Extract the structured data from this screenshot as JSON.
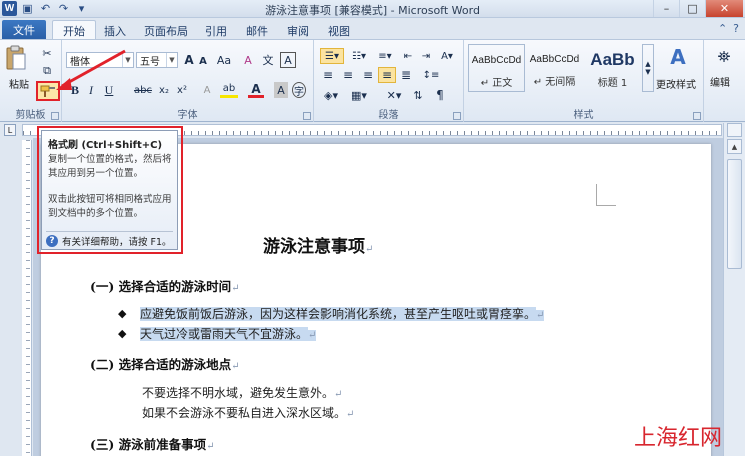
{
  "window": {
    "title": "游泳注意事项 [兼容模式] - Microsoft Word",
    "controls": {
      "minimize": "–",
      "maximize": "□",
      "close": "✕"
    }
  },
  "quick_access": {
    "logo": "W"
  },
  "tabs": {
    "file": "文件",
    "items": [
      "开始",
      "插入",
      "页面布局",
      "引用",
      "邮件",
      "审阅",
      "视图"
    ],
    "active": "开始"
  },
  "ribbon": {
    "clipboard": {
      "label": "剪贴板",
      "paste": "粘贴"
    },
    "font": {
      "label": "字体",
      "font_name": "楷体",
      "font_size": "五号",
      "grow": "A",
      "shrink": "A",
      "case": "Aa",
      "clear": "A",
      "bold": "B",
      "italic": "I",
      "underline": "U",
      "strike": "abc",
      "subscript": "x₂",
      "superscript": "x²",
      "highlight": "ab",
      "font_color": "A",
      "char_shading": "A",
      "char_border": "A",
      "phonetic": "文",
      "enclose": "字"
    },
    "paragraph": {
      "label": "段落"
    },
    "styles": {
      "label": "样式",
      "items": [
        {
          "sample": "AaBbCcDd",
          "name": "↵ 正文"
        },
        {
          "sample": "AaBbCcDd",
          "name": "↵ 无间隔"
        },
        {
          "sample": "AaBb",
          "name": "标题 1"
        }
      ],
      "change_styles": "更改样式"
    },
    "editing": {
      "label": "编辑"
    }
  },
  "tooltip": {
    "title": "格式刷 (Ctrl+Shift+C)",
    "body1": "复制一个位置的格式，然后将其应用到另一个位置。",
    "body2": "双击此按钮可将相同格式应用到文档中的多个位置。",
    "help": "有关详细帮助，请按 F1。"
  },
  "document": {
    "title": "游泳注意事项",
    "sections": [
      {
        "heading": "(一) 选择合适的游泳时间",
        "bullets": [
          "应避免饭前饭后游泳，因为这样会影响消化系统，甚至产生呕吐或胃痉挛。",
          "天气过冷或雷雨天气不宜游泳。"
        ]
      },
      {
        "heading": "(二) 选择合适的游泳地点",
        "lines": [
          "不要选择不明水域，避免发生意外。",
          "如果不会游泳不要私自进入深水区域。"
        ]
      },
      {
        "heading": "(三) 游泳前准备事项"
      }
    ],
    "para_mark": "↵",
    "bullet_glyph": "◆"
  },
  "watermark": "上海红网",
  "colors": {
    "highlight_red": "#e1222a",
    "selection": "#c7daf0",
    "accent": "#2b579a"
  }
}
